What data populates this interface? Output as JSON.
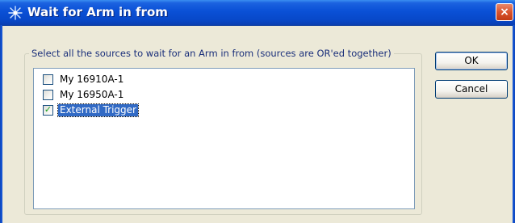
{
  "window": {
    "title": "Wait for Arm in from",
    "close_glyph": "×"
  },
  "group": {
    "legend": "Select all the sources to wait for an Arm in from (sources are OR'ed together)"
  },
  "sources": {
    "items": [
      {
        "label": "My 16910A-1",
        "checked": false,
        "selected": false
      },
      {
        "label": "My 16950A-1",
        "checked": false,
        "selected": false
      },
      {
        "label": "External Trigger",
        "checked": true,
        "selected": true
      }
    ]
  },
  "buttons": {
    "ok_label": "OK",
    "cancel_label": "Cancel"
  },
  "colors": {
    "titlebar": "#0a50d6",
    "selection": "#316ac5",
    "checkmark": "#21a121"
  },
  "icons": {
    "title_icon": "sparkle-icon",
    "check_mark": "✓"
  }
}
